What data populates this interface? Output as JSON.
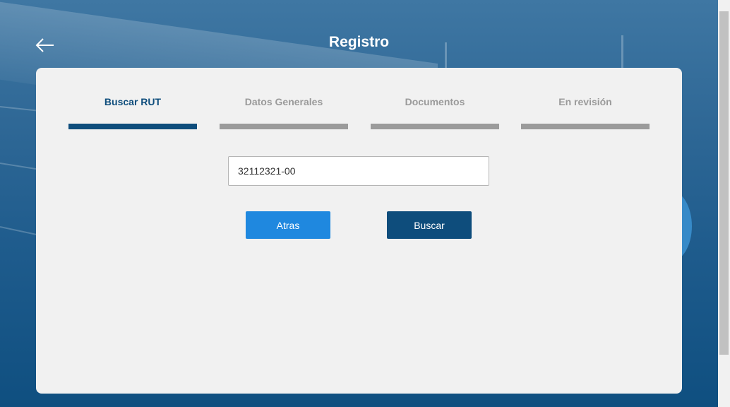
{
  "header": {
    "title": "Registro",
    "back_icon": "arrow-left-icon"
  },
  "steps": [
    {
      "label": "Buscar RUT",
      "active": true
    },
    {
      "label": "Datos Generales",
      "active": false
    },
    {
      "label": "Documentos",
      "active": false
    },
    {
      "label": "En revisión",
      "active": false
    }
  ],
  "form": {
    "rut_value": "32112321-00",
    "back_label": "Atras",
    "search_label": "Buscar"
  },
  "colors": {
    "primary_dark": "#0e4d7c",
    "primary_light": "#1f88df",
    "inactive_step": "#9b9b9b",
    "card_background": "#f1f1f1"
  }
}
